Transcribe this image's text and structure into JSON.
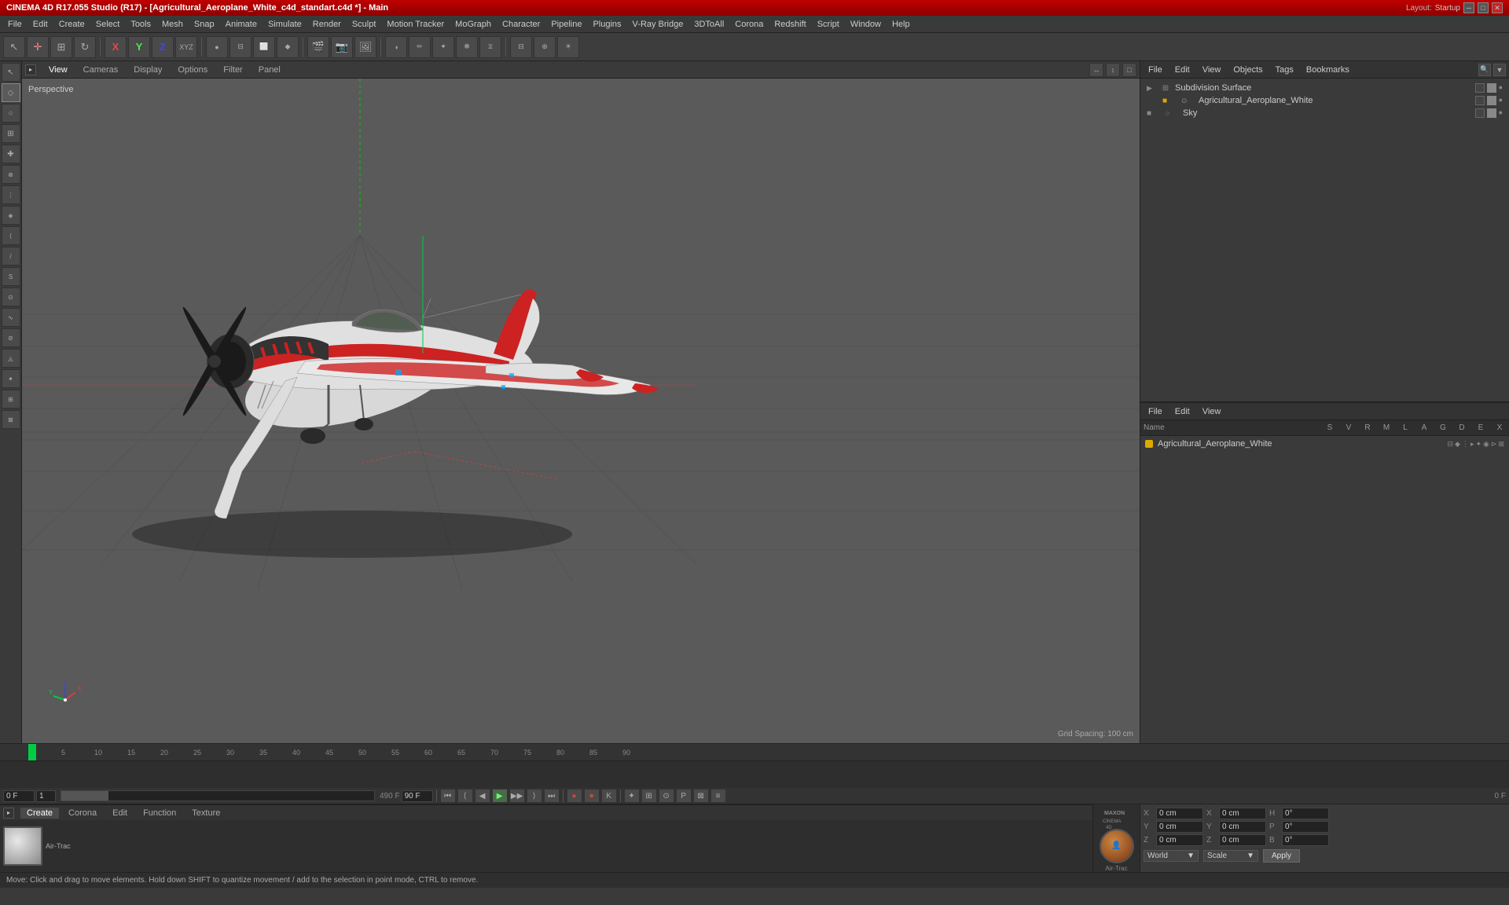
{
  "titlebar": {
    "title": "CINEMA 4D R17.055 Studio (R17) - [Agricultural_Aeroplane_White_c4d_standart.c4d *] - Main",
    "layout_label": "Layout:",
    "layout_value": "Startup"
  },
  "menubar": {
    "items": [
      "File",
      "Edit",
      "Create",
      "Select",
      "Tools",
      "Mesh",
      "Snap",
      "Animate",
      "Simulate",
      "Render",
      "Sculpt",
      "Motion Tracker",
      "MoGraph",
      "Character",
      "Pipeline",
      "Plugins",
      "V-Ray Bridge",
      "3DToAll",
      "Corona",
      "Redshift",
      "Script",
      "Window",
      "Help"
    ]
  },
  "viewport": {
    "tabs": [
      "View",
      "Cameras",
      "Display",
      "Options",
      "Filter",
      "Panel"
    ],
    "view_label": "Perspective",
    "grid_spacing": "Grid Spacing: 100 cm"
  },
  "scene_panel": {
    "toolbar_items": [
      "File",
      "Edit",
      "View",
      "Objects",
      "Tags",
      "Bookmarks"
    ],
    "items": [
      {
        "label": "Subdivision Surface",
        "type": "modifier",
        "indent": 0
      },
      {
        "label": "Agricultural_Aeroplane_White",
        "type": "object",
        "indent": 1,
        "color": "#ddaa00"
      },
      {
        "label": "Sky",
        "type": "object",
        "indent": 0,
        "color": "#888888"
      }
    ]
  },
  "object_panel": {
    "toolbar_items": [
      "File",
      "Edit",
      "View"
    ],
    "columns": [
      "Name",
      "S",
      "V",
      "R",
      "M",
      "L",
      "A",
      "G",
      "D",
      "E",
      "X"
    ],
    "items": [
      {
        "label": "Agricultural_Aeroplane_White",
        "color": "#ddaa00"
      }
    ]
  },
  "timeline": {
    "markers": [
      "0",
      "5",
      "10",
      "15",
      "20",
      "25",
      "30",
      "35",
      "40",
      "45",
      "50",
      "55",
      "60",
      "65",
      "70",
      "75",
      "80",
      "85",
      "90"
    ],
    "frame_end": "90 F",
    "current_frame": "0 F"
  },
  "transport": {
    "frame_current": "0 F",
    "frame_count": "1",
    "slider_val": "",
    "frame_end_val": "90 F"
  },
  "material_tabs": [
    "Create",
    "Corona",
    "Edit",
    "Function",
    "Texture"
  ],
  "material_thumb": {
    "label": "Air-Trac"
  },
  "coords": {
    "x_pos": "0 cm",
    "y_pos": "0 cm",
    "z_pos": "0 cm",
    "x_rot": "0 cm",
    "y_rot": "0 cm",
    "z_rot": "0 cm",
    "h_val": "0°",
    "p_val": "0°",
    "b_val": "0°"
  },
  "apply_bar": {
    "world_label": "World",
    "scale_label": "Scale",
    "apply_label": "Apply"
  },
  "statusbar": {
    "message": "Move: Click and drag to move elements. Hold down SHIFT to quantize movement / add to the selection in point mode, CTRL to remove."
  }
}
